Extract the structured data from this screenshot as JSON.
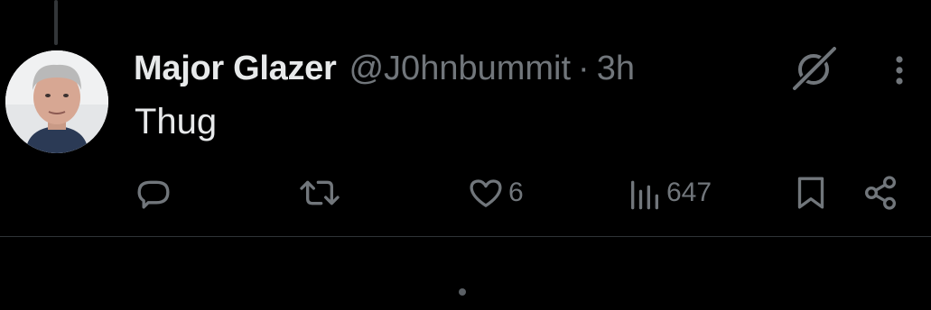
{
  "post": {
    "display_name": "Major Glazer",
    "handle": "@J0hnbummit",
    "separator": "·",
    "time": "3h",
    "text": "Thug",
    "avatar_icon": "user-avatar-photo"
  },
  "actions": {
    "reply_icon": "reply-icon",
    "repost_icon": "repost-icon",
    "like_icon": "heart-icon",
    "like_count": "6",
    "views_icon": "analytics-icon",
    "views_count": "647",
    "bookmark_icon": "bookmark-icon",
    "share_icon": "share-icon"
  },
  "colors": {
    "background": "#000000",
    "primary_text": "#e7e9ea",
    "secondary_text": "#71767b",
    "divider": "#2f3336"
  }
}
